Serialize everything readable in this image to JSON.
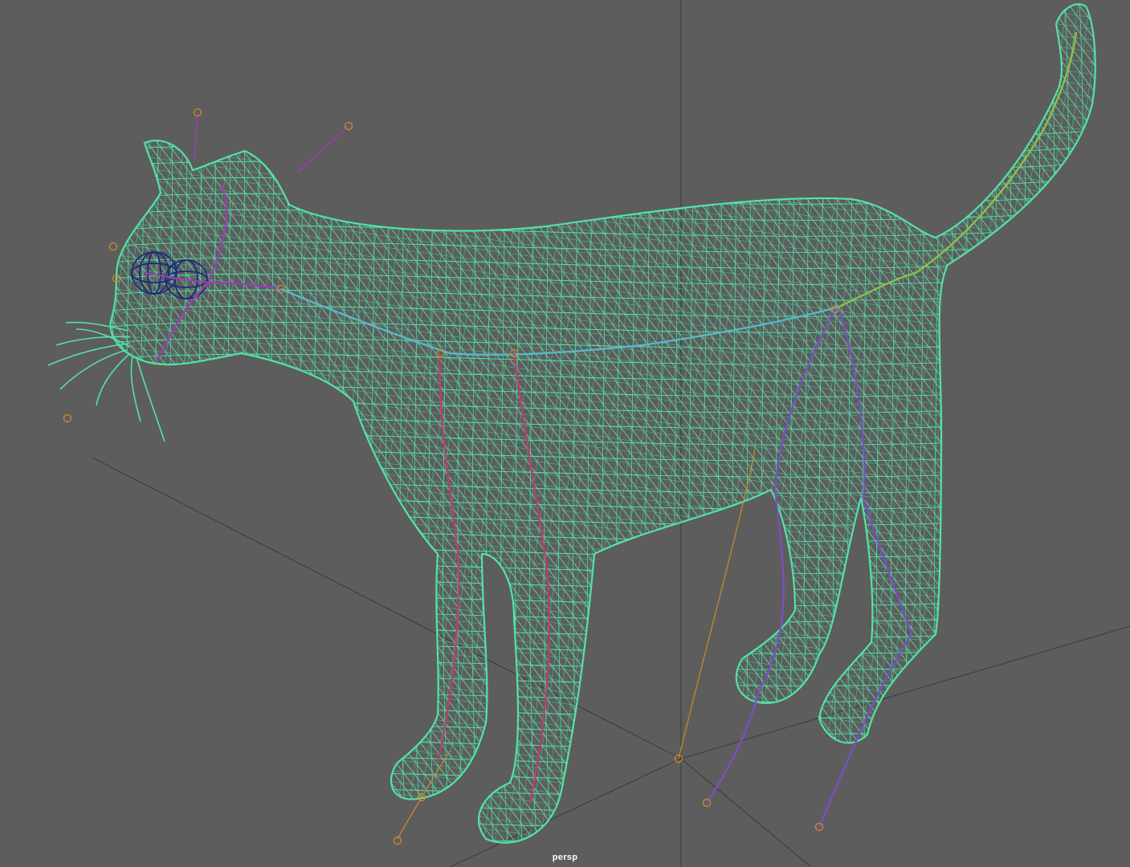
{
  "viewport": {
    "camera": "persp",
    "background_color": "#5d5d5d",
    "grid_color": "#3f3f3f",
    "axis_line_color": "#2c4a2e",
    "mesh_color": "#52e3a5",
    "eye_color": "#1f2a7a",
    "joint_colors": {
      "spine": "#5bb7c9",
      "head": "#9a3fb0",
      "front_leg": "#b8406e",
      "rear_leg": "#7a4fc0",
      "tail": "#8fbf4a",
      "locator": "#d28a2c"
    }
  },
  "scene": {
    "object": "cat-mesh",
    "display_mode": "wireframe",
    "skeleton": "visible",
    "icons": [
      "joint-locator-icon",
      "pivot-icon"
    ]
  }
}
